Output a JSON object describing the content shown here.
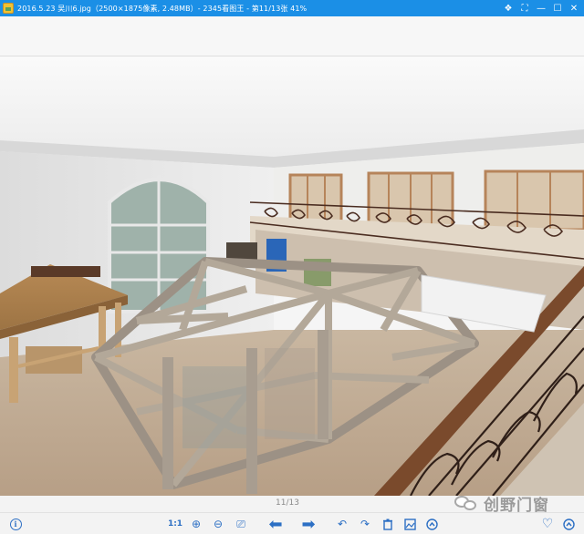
{
  "window": {
    "title": "2016.5.23 吴川6.jpg（2500×1875像素, 2.48MB）- 2345看图王 - 第11/13张 41%",
    "controls": {
      "skin": "❖",
      "fullscreen": "⛶",
      "minimize": "—",
      "maximize": "☐",
      "close": "✕"
    }
  },
  "viewer": {
    "image_alt": "3D rendering of interior atrium with glass roof frame, wrought-iron balcony railing and gazebo"
  },
  "pagebar": {
    "indicator": "11/13"
  },
  "watermark": {
    "text": "创野门窗"
  },
  "toolbar": {
    "info_glyph": "i",
    "actual_size_label": "1:1",
    "zoom_in": "⊕",
    "zoom_out": "⊖",
    "fit": "⎚",
    "prev": "⬅",
    "next": "➡",
    "rotate_left": "↶",
    "rotate_right": "↷",
    "delete": "🗑",
    "edit": "✎",
    "more": "⌃",
    "favorite": "♡",
    "menu": "⌃"
  },
  "colors": {
    "titlebar": "#1b8fe6",
    "toolbar_icon": "#2c6fc4"
  }
}
